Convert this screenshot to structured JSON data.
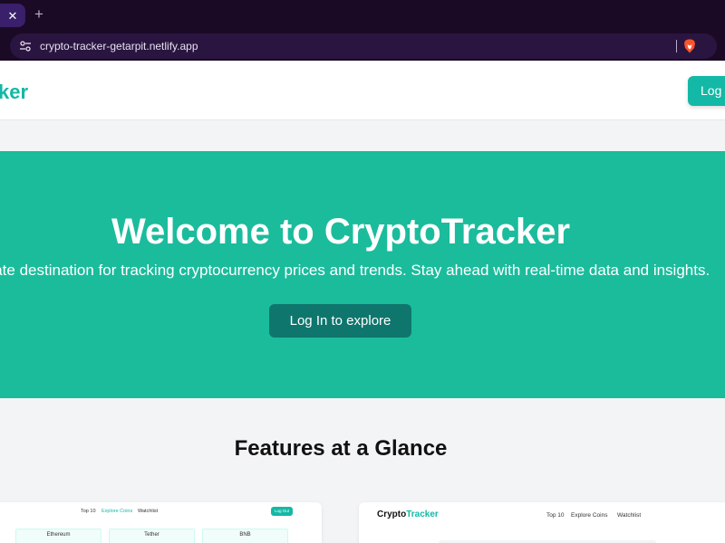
{
  "browser": {
    "tab_close_glyph": "✕",
    "new_tab_glyph": "+",
    "url": "crypto-tracker-getarpit.netlify.app",
    "site_info_icon": "tune-icon",
    "brave_icon": "brave-lion-icon"
  },
  "header": {
    "logo_fragment": "ker",
    "login_label": "Log In"
  },
  "hero": {
    "title": "Welcome to CryptoTracker",
    "subtitle": "ltimate destination for tracking cryptocurrency prices and trends. Stay ahead with real-time data and insights.",
    "cta_label": "Log In to explore"
  },
  "features": {
    "title": "Features at a Glance",
    "card_left": {
      "nav": [
        "Top 10",
        "Explore Coins",
        "Watchlist"
      ],
      "logout": "Log Out",
      "coins": [
        "Ethereum",
        "Tether",
        "BNB"
      ]
    },
    "card_right": {
      "logo_prefix": "Crypto",
      "logo_accent": "Tracker",
      "nav": [
        "Top 10",
        "Explore Coins",
        "Watchlist"
      ]
    }
  },
  "colors": {
    "accent": "#14b8a6",
    "hero_bg": "#1abc9c",
    "cta_bg": "#0f766e",
    "browser_bg": "#1a0a26"
  }
}
